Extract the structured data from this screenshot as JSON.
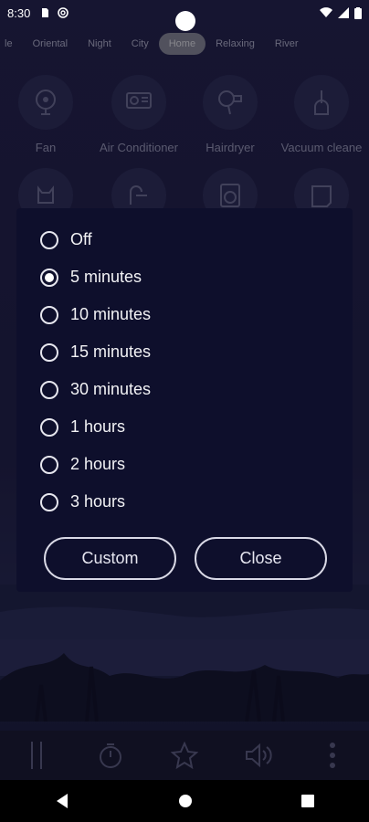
{
  "status_bar": {
    "time": "8:30",
    "icons": [
      "sim-card-icon",
      "at-sign-icon",
      "wifi-icon",
      "signal-icon",
      "battery-icon"
    ]
  },
  "tabs": [
    {
      "label": "le",
      "active": false
    },
    {
      "label": "Oriental",
      "active": false
    },
    {
      "label": "Night",
      "active": false
    },
    {
      "label": "City",
      "active": false
    },
    {
      "label": "Home",
      "active": true
    },
    {
      "label": "Relaxing",
      "active": false
    },
    {
      "label": "River",
      "active": false
    }
  ],
  "sounds": [
    {
      "label": "Fan",
      "icon": "fan-icon"
    },
    {
      "label": "Air Conditioner",
      "icon": "air-conditioner-icon"
    },
    {
      "label": "Hairdryer",
      "icon": "hairdryer-icon"
    },
    {
      "label": "Vacuum cleane",
      "icon": "vacuum-cleaner-icon"
    },
    {
      "label": "",
      "icon": "cat-icon"
    },
    {
      "label": "",
      "icon": "shower-icon"
    },
    {
      "label": "",
      "icon": "washing-machine-icon"
    },
    {
      "label": "",
      "icon": "paper-icon"
    }
  ],
  "timer_dialog": {
    "options": [
      {
        "label": "Off",
        "checked": false
      },
      {
        "label": "5 minutes",
        "checked": true
      },
      {
        "label": "10 minutes",
        "checked": false
      },
      {
        "label": "15 minutes",
        "checked": false
      },
      {
        "label": "30 minutes",
        "checked": false
      },
      {
        "label": "1 hours",
        "checked": false
      },
      {
        "label": "2 hours",
        "checked": false
      },
      {
        "label": "3 hours",
        "checked": false
      }
    ],
    "custom_label": "Custom",
    "close_label": "Close"
  },
  "player": {
    "icons": [
      "pause-icon",
      "timer-icon",
      "star-icon",
      "volume-icon",
      "more-vertical-icon"
    ]
  },
  "colors": {
    "background": "#1f1e45",
    "dialog": "#0e0f2c",
    "active_tab": "#8a8a95"
  }
}
